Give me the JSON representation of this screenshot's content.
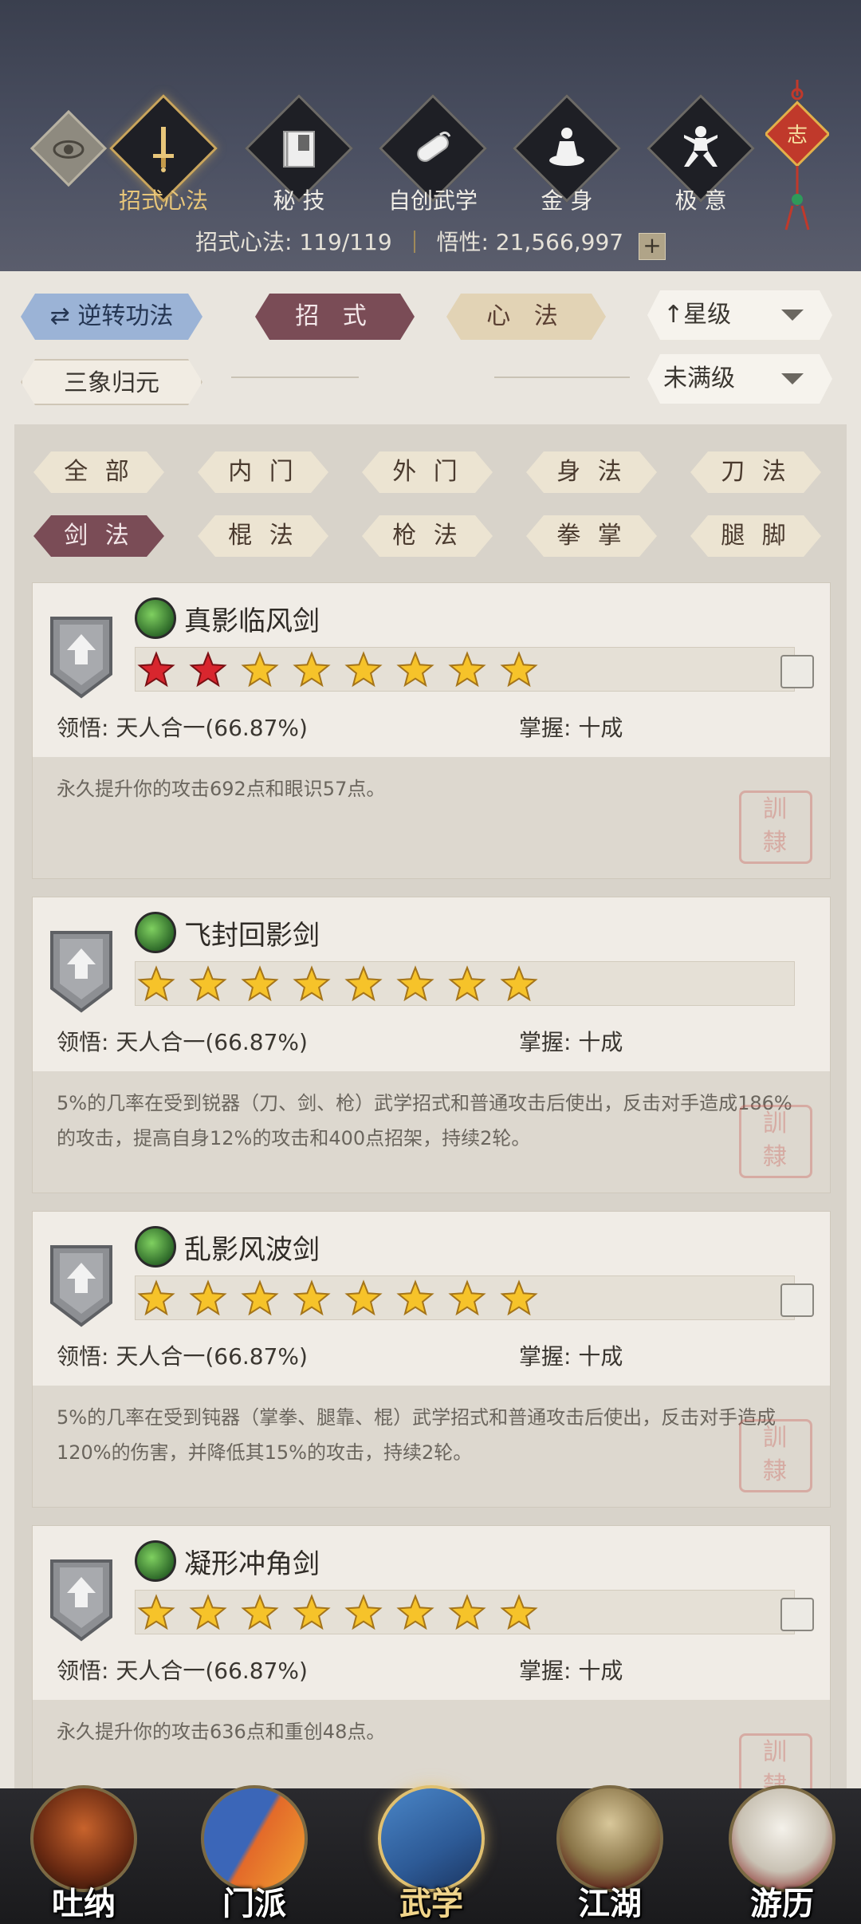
{
  "header": {
    "nav": [
      {
        "label": "招式心法",
        "icon": "sword-icon",
        "active": true
      },
      {
        "label": "秘 技",
        "icon": "book-icon",
        "active": false
      },
      {
        "label": "自创武学",
        "icon": "scroll-icon",
        "active": false
      },
      {
        "label": "金 身",
        "icon": "meditation-icon",
        "active": false
      },
      {
        "label": "极 意",
        "icon": "martial-pose-icon",
        "active": false
      }
    ],
    "stat_label": "招式心法:",
    "stat_value": "119/119",
    "comprehension_label": "悟性:",
    "comprehension_value": "21,566,997",
    "plus": "+"
  },
  "controls": {
    "reverse_label": "逆转功法",
    "moves_label": "招 式",
    "mind_label": "心 法",
    "sort_label": "星级",
    "sanxiang_label": "三象归元",
    "level_filter": "未满级"
  },
  "filters": {
    "row1": [
      "全 部",
      "内 门",
      "外 门",
      "身 法",
      "刀 法"
    ],
    "row2": [
      "剑 法",
      "棍 法",
      "枪 法",
      "拳 掌",
      "腿 脚"
    ],
    "active": "剑 法"
  },
  "cards": [
    {
      "name": "真影临风剑",
      "stars_red": 2,
      "stars_total": 8,
      "insight_label": "领悟:",
      "insight_value": "天人合一(66.87%)",
      "mastery_label": "掌握:",
      "mastery_value": "十成",
      "desc": "永久提升你的攻击692点和眼识57点。",
      "mini_icon": true
    },
    {
      "name": "飞封回影剑",
      "stars_red": 0,
      "stars_total": 8,
      "insight_label": "领悟:",
      "insight_value": "天人合一(66.87%)",
      "mastery_label": "掌握:",
      "mastery_value": "十成",
      "desc": "5%的几率在受到锐器（刀、剑、枪）武学招式和普通攻击后使出，反击对手造成186%的攻击，提高自身12%的攻击和400点招架，持续2轮。",
      "mini_icon": false
    },
    {
      "name": "乱影风波剑",
      "stars_red": 0,
      "stars_total": 8,
      "insight_label": "领悟:",
      "insight_value": "天人合一(66.87%)",
      "mastery_label": "掌握:",
      "mastery_value": "十成",
      "desc": "5%的几率在受到钝器（掌拳、腿靠、棍）武学招式和普通攻击后使出，反击对手造成120%的伤害，并降低其15%的攻击，持续2轮。",
      "mini_icon": true
    },
    {
      "name": "凝形冲角剑",
      "stars_red": 0,
      "stars_total": 8,
      "insight_label": "领悟:",
      "insight_value": "天人合一(66.87%)",
      "mastery_label": "掌握:",
      "mastery_value": "十成",
      "desc": "永久提升你的攻击636点和重创48点。",
      "mini_icon": true
    }
  ],
  "bottom_nav": [
    {
      "label": "吐纳",
      "active": false
    },
    {
      "label": "门派",
      "active": false
    },
    {
      "label": "武学",
      "active": true
    },
    {
      "label": "江湖",
      "active": false
    },
    {
      "label": "游历",
      "active": false
    }
  ]
}
